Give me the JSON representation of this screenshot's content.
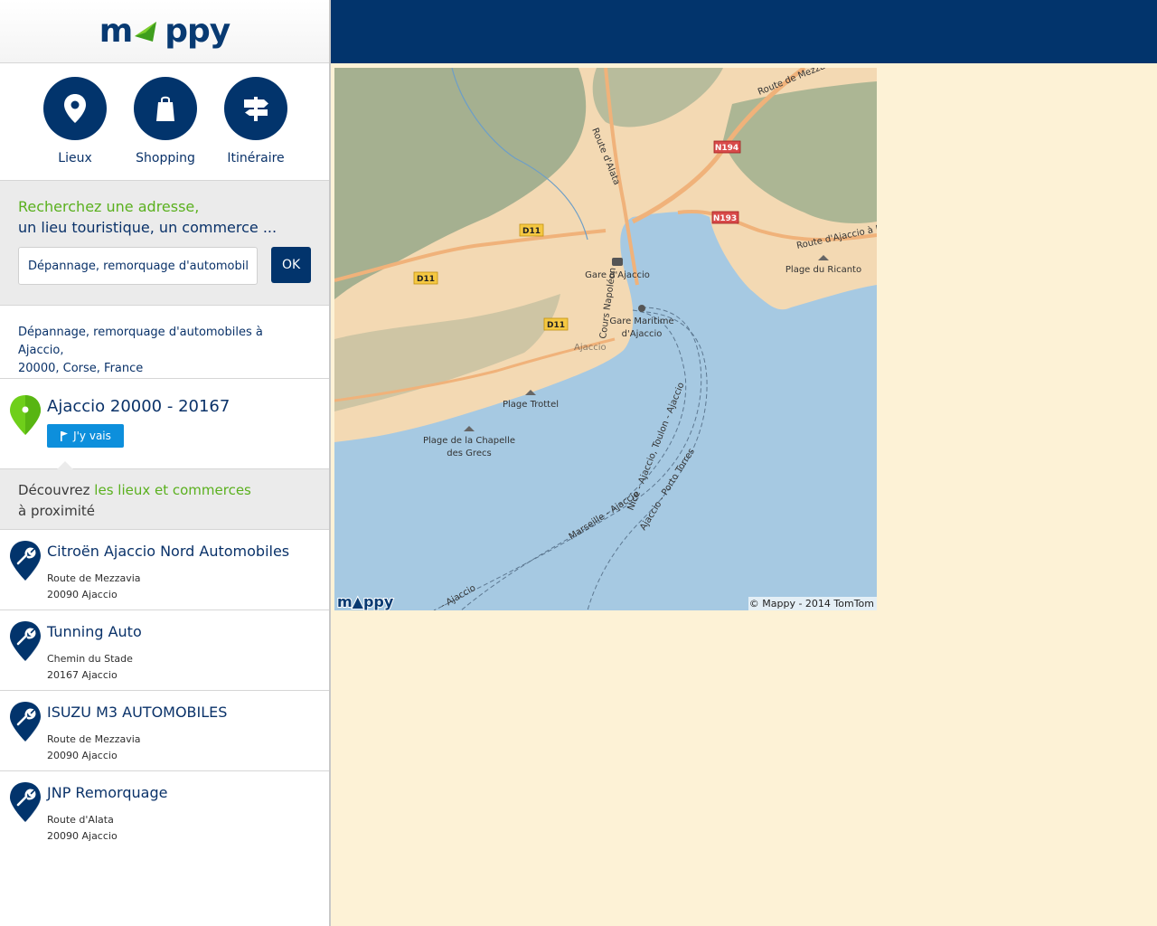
{
  "brand": {
    "logo_text_left": "m",
    "logo_text_right": "ppy"
  },
  "nav": {
    "items": [
      {
        "label": "Lieux",
        "icon": "location-pin-icon"
      },
      {
        "label": "Shopping",
        "icon": "shopping-bag-icon"
      },
      {
        "label": "Itinéraire",
        "icon": "signpost-icon"
      }
    ]
  },
  "search": {
    "prompt_line1": "Recherchez une adresse,",
    "prompt_line2": "un lieu touristique, un commerce ...",
    "value": "Dépannage, remorquage d'automobiles",
    "ok_label": "OK"
  },
  "result": {
    "title_line1": "Dépannage, remorquage d'automobiles à Ajaccio,",
    "title_line2": "20000, Corse, France"
  },
  "place": {
    "name": "Ajaccio 20000 - 20167",
    "go_label": "J'y vais"
  },
  "discover": {
    "prefix": "Découvrez ",
    "link": "les lieux et commerces",
    "suffix": "à proximité"
  },
  "pois": [
    {
      "name": "Citroën Ajaccio Nord Automobiles",
      "street": "Route de Mezzavia",
      "city": "20090 Ajaccio"
    },
    {
      "name": "Tunning Auto",
      "street": "Chemin du Stade",
      "city": "20167 Ajaccio"
    },
    {
      "name": "ISUZU M3 AUTOMOBILES",
      "street": "Route de Mezzavia",
      "city": "20090 Ajaccio"
    },
    {
      "name": "JNP Remorquage",
      "street": "Route d'Alata",
      "city": "20090 Ajaccio"
    }
  ],
  "map": {
    "labels": {
      "gare": "Gare d'Ajaccio",
      "gare_maritime_1": "Gare Maritime",
      "gare_maritime_2": "d'Ajaccio",
      "plage_trottel": "Plage Trottel",
      "plage_chapelle_1": "Plage de la Chapelle",
      "plage_chapelle_2": "des Grecs",
      "plage_ricanto": "Plage du Ricanto",
      "route_mezzavia": "Route de Mezzavia",
      "route_alata": "Route d'Alata",
      "route_bonifacio": "Route d'Ajaccio à Bonifacio",
      "cours_napoleon": "Cours Napoléon",
      "ferry_marseille": "Marseille - Ajaccio",
      "ferry_nice": "Nice - Ajaccio, Toulon - Ajaccio",
      "ferry_porto": "Ajaccio - Porto Torres",
      "ferry_edge": "- Ajaccio",
      "city": "Ajaccio",
      "d11": "D11",
      "n194": "N194",
      "n193": "N193"
    },
    "watermark": "m▲ppy",
    "copyright": "© Mappy - 2014 TomTom"
  },
  "colors": {
    "brand_navy": "#02346c",
    "brand_green": "#5ab01e",
    "button_blue": "#0d8fdc",
    "sea": "#a6c9e2",
    "land": "#f3d9b3"
  }
}
